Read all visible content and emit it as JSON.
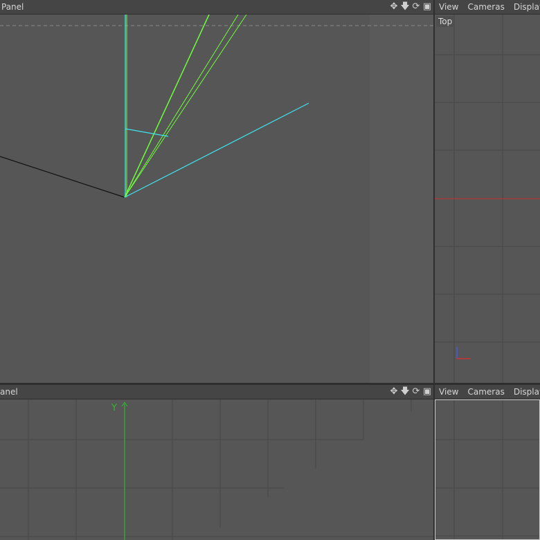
{
  "perspective_panel": {
    "title": "Panel",
    "icons": [
      "move-icon",
      "pan-down-icon",
      "rotate-icon",
      "maximize-icon"
    ]
  },
  "top_panel": {
    "menus": [
      "View",
      "Cameras",
      "Display"
    ],
    "view_label": "Top"
  },
  "front_panel": {
    "title": "anel",
    "icons": [
      "move-icon",
      "pan-down-icon",
      "rotate-icon",
      "maximize-icon"
    ],
    "axis_label": "Y"
  },
  "side_panel": {
    "menus": [
      "View",
      "Cameras",
      "Display"
    ]
  },
  "colors": {
    "background": "#565656",
    "grid": "#474747",
    "camera_green": "#6dff3a",
    "camera_cyan": "#3fe3ef",
    "axis_red": "#c83232",
    "axis_green": "#2fb82f"
  }
}
